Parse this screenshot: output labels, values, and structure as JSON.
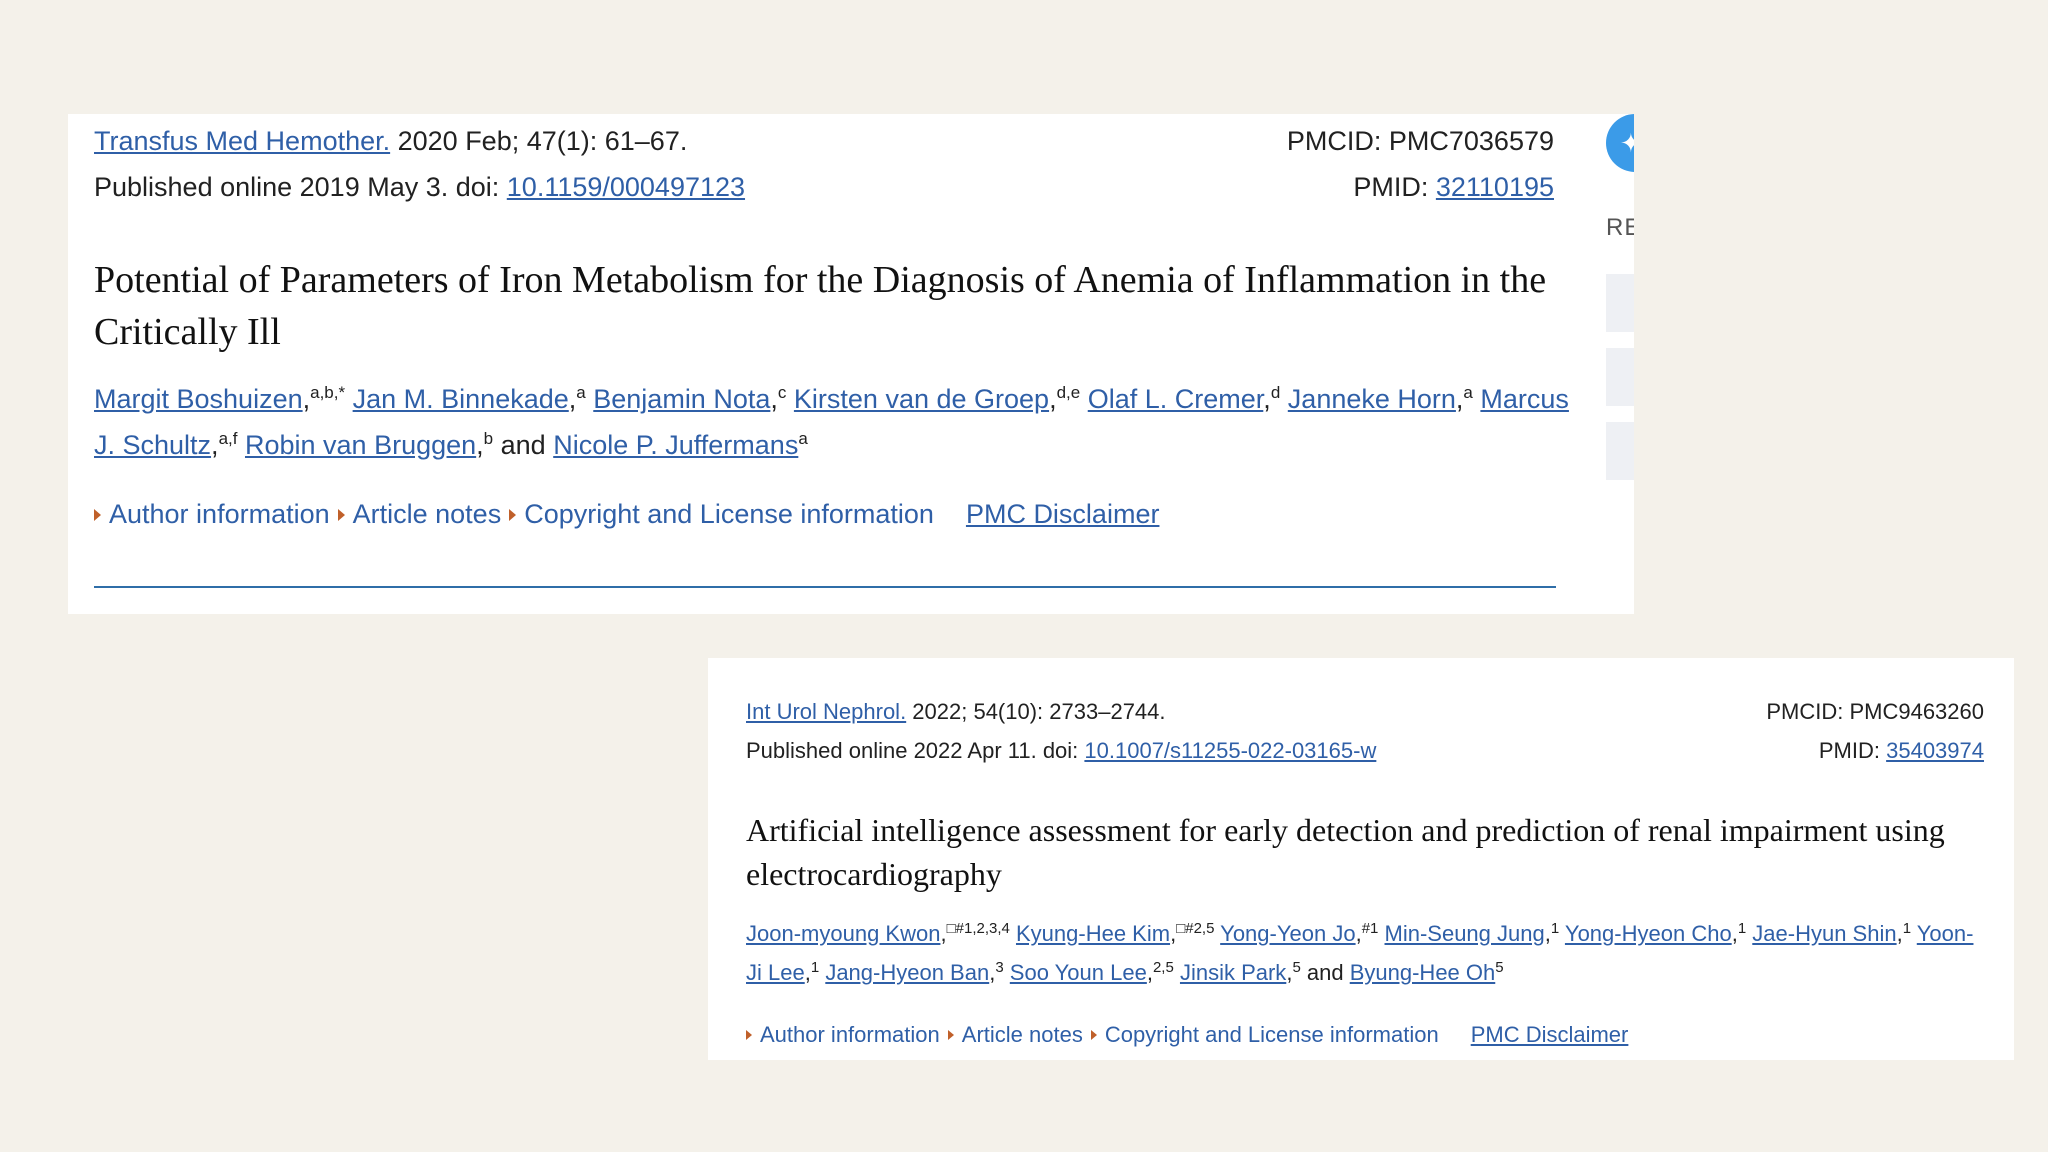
{
  "articles": [
    {
      "journal": "Transfus Med Hemother.",
      "citation": " 2020 Feb; 47(1): 61–67.",
      "published_prefix": "Published online 2019 May 3. doi: ",
      "doi": "10.1159/000497123",
      "pmcid": "PMCID: PMC7036579",
      "pmid_label": "PMID: ",
      "pmid": "32110195",
      "title": "Potential of Parameters of Iron Metabolism for the Diagnosis of Anemia of Inflammation in the Critically Ill",
      "authors": [
        {
          "name": "Margit Boshuizen",
          "sup": "a,b,*",
          "sep": " "
        },
        {
          "name": "Jan M. Binnekade",
          "sup": "a",
          "sep": " "
        },
        {
          "name": "Benjamin Nota",
          "sup": "c",
          "sep": " "
        },
        {
          "name": "Kirsten van de Groep",
          "sup": "d,e",
          "sep": " "
        },
        {
          "name": "Olaf L. Cremer",
          "sup": "d",
          "sep": " "
        },
        {
          "name": "Janneke Horn",
          "sup": "a",
          "sep": " "
        },
        {
          "name": "Marcus J. Schultz",
          "sup": "a,f",
          "sep": " "
        },
        {
          "name": "Robin van Bruggen",
          "sup": "b",
          "sep": " and "
        },
        {
          "name": "Nicole P. Juffermans",
          "sup": "a",
          "sep": ""
        }
      ],
      "info_links": [
        "Author information",
        "Article notes",
        "Copyright and License information"
      ],
      "disclaimer": "PMC Disclaimer"
    },
    {
      "journal": "Int Urol Nephrol.",
      "citation": " 2022; 54(10): 2733–2744.",
      "published_prefix": "Published online 2022 Apr 11. doi: ",
      "doi": "10.1007/s11255-022-03165-w",
      "pmcid": "PMCID: PMC9463260",
      "pmid_label": "PMID: ",
      "pmid": "35403974",
      "title": "Artificial intelligence assessment for early detection and prediction of renal impairment using electrocardiography",
      "authors": [
        {
          "name": "Joon-myoung Kwon",
          "sup": "□#1,2,3,4",
          "sep": " "
        },
        {
          "name": "Kyung-Hee Kim",
          "sup": "□#2,5",
          "sep": " "
        },
        {
          "name": "Yong-Yeon Jo",
          "sup": "#1",
          "sep": " "
        },
        {
          "name": "Min-Seung Jung",
          "sup": "1",
          "sep": " "
        },
        {
          "name": "Yong-Hyeon Cho",
          "sup": "1",
          "sep": " "
        },
        {
          "name": "Jae-Hyun Shin",
          "sup": "1",
          "sep": " "
        },
        {
          "name": "Yoon-Ji Lee",
          "sup": "1",
          "sep": " "
        },
        {
          "name": "Jang-Hyeon Ban",
          "sup": "3",
          "sep": " "
        },
        {
          "name": "Soo Youn Lee",
          "sup": "2,5",
          "sep": " "
        },
        {
          "name": "Jinsik Park",
          "sup": "5",
          "sep": " and "
        },
        {
          "name": "Byung-Hee Oh",
          "sup": "5",
          "sep": ""
        }
      ],
      "info_links": [
        "Author information",
        "Article notes",
        "Copyright and License information"
      ],
      "disclaimer": "PMC Disclaimer"
    }
  ],
  "side_widget": {
    "icon": "twitter-icon",
    "text": "RE"
  },
  "colors": {
    "background": "#f4f1ea",
    "link": "#2f5fa7",
    "caret": "#c0602a",
    "twitter": "#3b9be8"
  }
}
